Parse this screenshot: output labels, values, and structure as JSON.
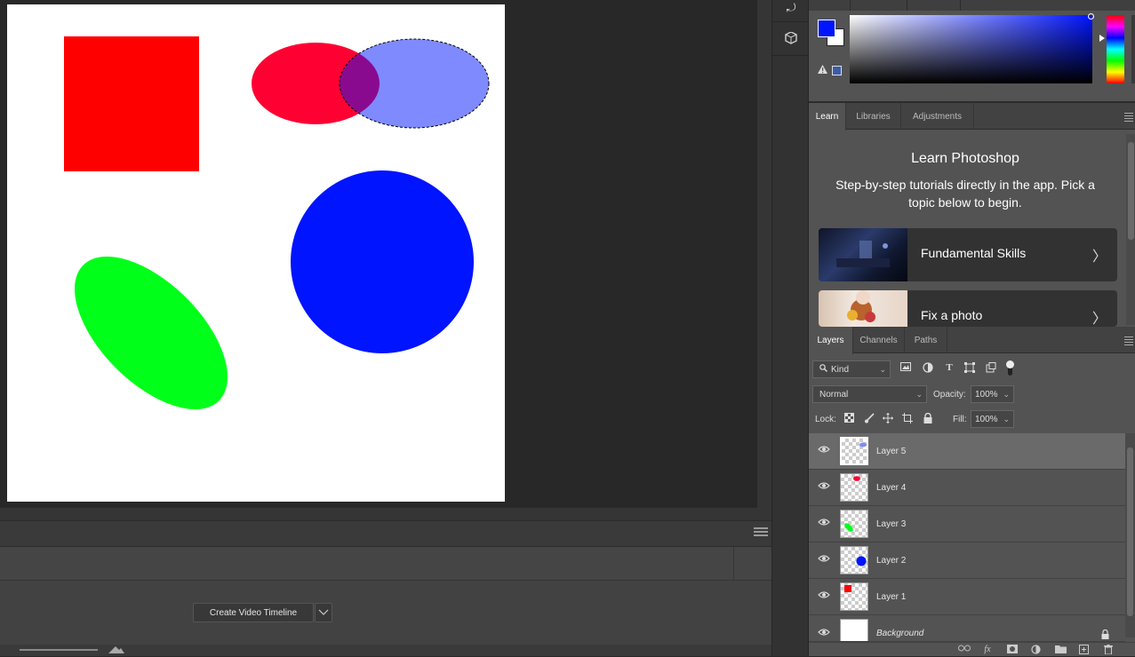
{
  "canvas": {
    "shapes": [
      {
        "name": "red-square",
        "color": "#ff0000"
      },
      {
        "name": "red-ellipse",
        "color": "#ff0033"
      },
      {
        "name": "blue-ellipse-selected",
        "color": "#7f8aff"
      },
      {
        "name": "overlap",
        "color": "#8a0a8f"
      },
      {
        "name": "blue-circle",
        "color": "#0014ff"
      },
      {
        "name": "green-ellipse",
        "color": "#00ff19"
      }
    ]
  },
  "timeline": {
    "create_button_label": "Create Video Timeline"
  },
  "color_panel": {
    "foreground": "#0014ff",
    "background": "#ffffff"
  },
  "learn_panel": {
    "tabs": [
      "Learn",
      "Libraries",
      "Adjustments"
    ],
    "title": "Learn Photoshop",
    "description": "Step-by-step tutorials directly in the app. Pick a topic below to begin.",
    "cards": [
      {
        "label": "Fundamental Skills",
        "chevron": "〉"
      },
      {
        "label": "Fix a photo",
        "chevron": "〉"
      }
    ]
  },
  "layers_panel": {
    "tabs": [
      "Layers",
      "Channels",
      "Paths"
    ],
    "filter_kind": "Kind",
    "blend_mode": "Normal",
    "opacity_label": "Opacity:",
    "opacity_value": "100%",
    "lock_label": "Lock:",
    "fill_label": "Fill:",
    "fill_value": "100%",
    "layers": [
      {
        "name": "Layer 5",
        "selected": true
      },
      {
        "name": "Layer 4",
        "selected": false
      },
      {
        "name": "Layer 3",
        "selected": false
      },
      {
        "name": "Layer 2",
        "selected": false
      },
      {
        "name": "Layer 1",
        "selected": false
      },
      {
        "name": "Background",
        "selected": false,
        "locked": true
      }
    ]
  }
}
